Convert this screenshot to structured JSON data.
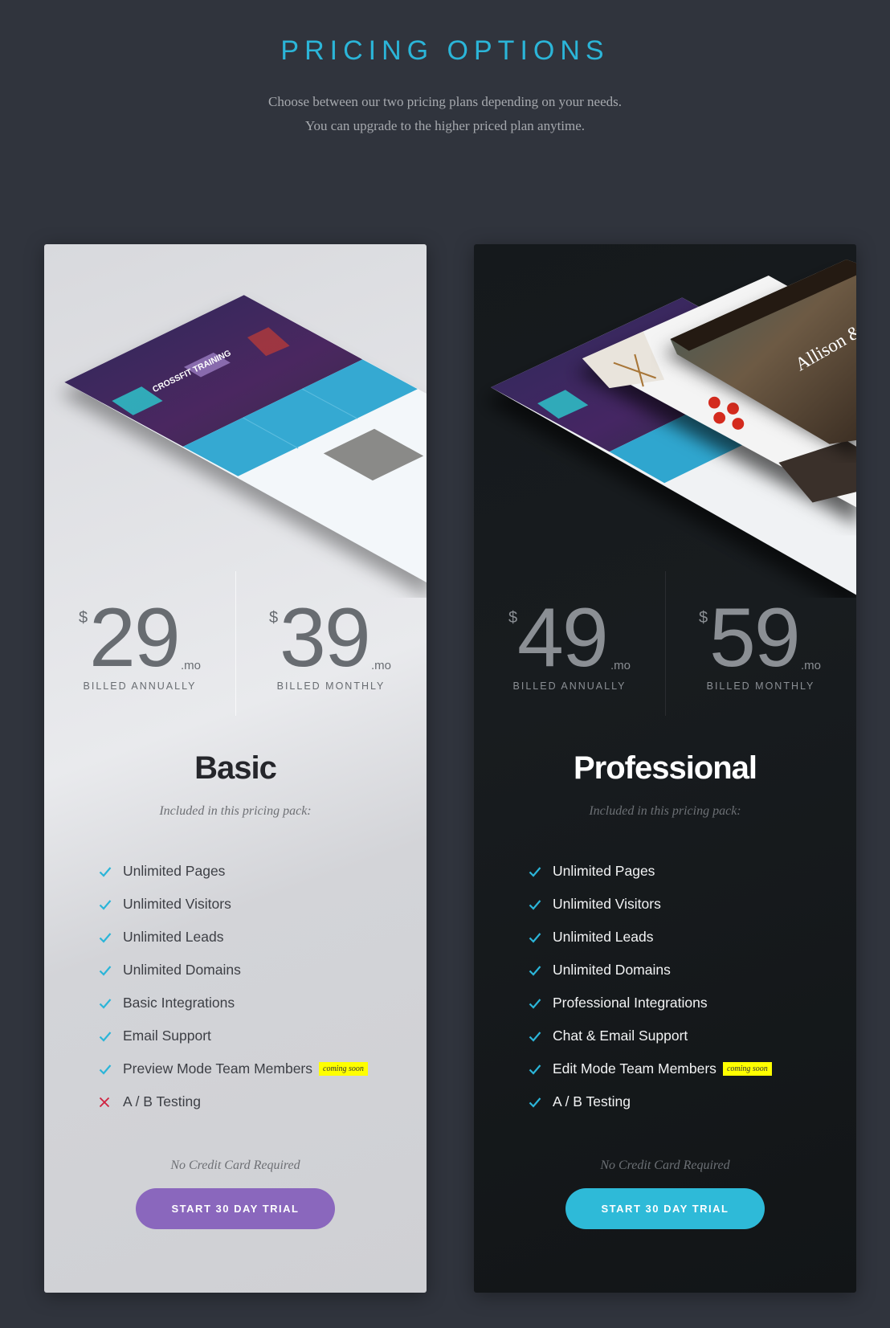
{
  "header": {
    "title": "PRICING OPTIONS",
    "subtitle_line1": "Choose between our two pricing plans depending on your needs.",
    "subtitle_line2": "You can upgrade to the higher priced plan anytime."
  },
  "colors": {
    "accent": "#2bb5d8",
    "basic_button": "#8a67bd",
    "pro_button": "#2ebad8",
    "cross": "#d0213f",
    "badge": "#ffff00"
  },
  "plans": [
    {
      "name": "Basic",
      "prices": [
        {
          "currency": "$",
          "amount": "29",
          "period": ".mo",
          "billing": "BILLED ANNUALLY"
        },
        {
          "currency": "$",
          "amount": "39",
          "period": ".mo",
          "billing": "BILLED MONTHLY"
        }
      ],
      "included_label": "Included in this pricing pack:",
      "features": [
        {
          "label": "Unlimited Pages",
          "icon": "check-icon"
        },
        {
          "label": "Unlimited Visitors",
          "icon": "check-icon"
        },
        {
          "label": "Unlimited Leads",
          "icon": "check-icon"
        },
        {
          "label": "Unlimited Domains",
          "icon": "check-icon"
        },
        {
          "label": "Basic Integrations",
          "icon": "check-icon"
        },
        {
          "label": "Email Support",
          "icon": "check-icon"
        },
        {
          "label": "Preview Mode Team Members",
          "icon": "check-icon",
          "badge": "coming soon"
        },
        {
          "label": "A / B Testing",
          "icon": "cross-icon"
        }
      ],
      "note": "No Credit Card Required",
      "button": "START 30 DAY TRIAL"
    },
    {
      "name": "Professional",
      "prices": [
        {
          "currency": "$",
          "amount": "49",
          "period": ".mo",
          "billing": "BILLED ANNUALLY"
        },
        {
          "currency": "$",
          "amount": "59",
          "period": ".mo",
          "billing": "BILLED MONTHLY"
        }
      ],
      "included_label": "Included in this pricing pack:",
      "features": [
        {
          "label": "Unlimited Pages",
          "icon": "check-icon"
        },
        {
          "label": "Unlimited Visitors",
          "icon": "check-icon"
        },
        {
          "label": "Unlimited Leads",
          "icon": "check-icon"
        },
        {
          "label": "Unlimited Domains",
          "icon": "check-icon"
        },
        {
          "label": "Professional Integrations",
          "icon": "check-icon"
        },
        {
          "label": "Chat & Email Support",
          "icon": "check-icon"
        },
        {
          "label": "Edit Mode Team Members",
          "icon": "check-icon",
          "badge": "coming soon"
        },
        {
          "label": "A / B Testing",
          "icon": "check-icon"
        }
      ],
      "note": "No Credit Card Required",
      "button": "START 30 DAY TRIAL"
    }
  ]
}
